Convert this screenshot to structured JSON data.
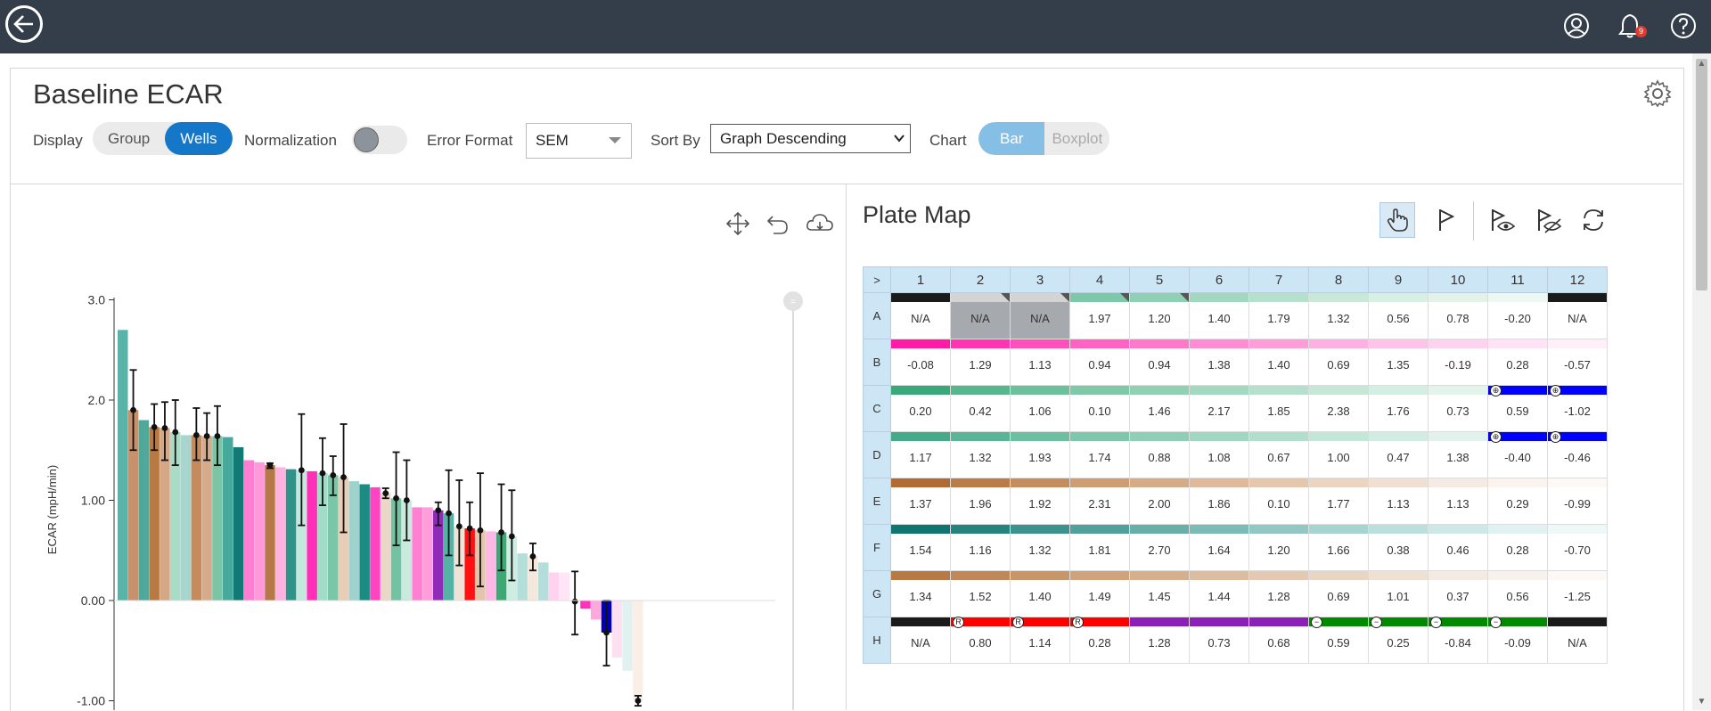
{
  "page": {
    "title": "Baseline ECAR",
    "notification_count": "9"
  },
  "toolbar": {
    "display_label": "Display",
    "display_options": [
      "Group",
      "Wells"
    ],
    "display_selected": "Wells",
    "normalization_label": "Normalization",
    "normalization_on": false,
    "error_format_label": "Error Format",
    "error_format_value": "SEM",
    "sort_by_label": "Sort By",
    "sort_by_value": "Graph Descending",
    "chart_label": "Chart",
    "chart_options": [
      "Bar",
      "Boxplot"
    ],
    "chart_selected": "Bar"
  },
  "icons": {
    "top": [
      "back-arrow-icon",
      "user-icon",
      "bell-icon",
      "help-icon"
    ],
    "panel": [
      "gear-icon"
    ],
    "chart_tools": [
      "pan-icon",
      "undo-icon",
      "cloud-download-icon"
    ],
    "plate_tools": [
      "hand-pointer-icon",
      "flag-icon",
      "flag-show-icon",
      "flag-hide-icon",
      "refresh-icon"
    ]
  },
  "chart_data": {
    "type": "bar",
    "ylabel": "ECAR (mpH/min)",
    "yticks": [
      "3.0",
      "2.0",
      "1.00",
      "0.00",
      "-1.00"
    ],
    "ylim": [
      -1.0,
      3.0
    ],
    "grid": false,
    "bars": [
      {
        "v": 2.7,
        "c": "#5ab3a8"
      },
      {
        "v": 1.9,
        "c": "#c7926b",
        "e": [
          1.5,
          2.3
        ]
      },
      {
        "v": 1.8,
        "c": "#4fa899"
      },
      {
        "v": 1.73,
        "c": "#b87a43",
        "e": [
          1.5,
          1.96
        ]
      },
      {
        "v": 1.72,
        "c": "#d4a886",
        "e": [
          1.4,
          1.98
        ]
      },
      {
        "v": 1.68,
        "c": "#a9dcc6",
        "e": [
          1.35,
          2.0
        ]
      },
      {
        "v": 1.65,
        "c": "#a8d5cf"
      },
      {
        "v": 1.65,
        "c": "#c58b5c",
        "e": [
          1.4,
          1.92
        ]
      },
      {
        "v": 1.64,
        "c": "#d6ab8c",
        "e": [
          1.4,
          1.87
        ]
      },
      {
        "v": 1.64,
        "c": "#7cc4a4",
        "e": [
          1.35,
          1.94
        ]
      },
      {
        "v": 1.63,
        "c": "#47a99b"
      },
      {
        "v": 1.53,
        "c": "#117a74"
      },
      {
        "v": 1.4,
        "c": "#ff7ed2"
      },
      {
        "v": 1.38,
        "c": "#ff9ad9"
      },
      {
        "v": 1.35,
        "c": "#b67847",
        "e": [
          1.32,
          1.37
        ]
      },
      {
        "v": 1.33,
        "c": "#ffb1e1"
      },
      {
        "v": 1.31,
        "c": "#2f938a"
      },
      {
        "v": 1.3,
        "c": "#c3e8dd",
        "e": [
          0.75,
          1.86
        ]
      },
      {
        "v": 1.29,
        "c": "#ff2fb8"
      },
      {
        "v": 1.27,
        "c": "#a3dbc9",
        "e": [
          0.95,
          1.62
        ]
      },
      {
        "v": 1.25,
        "c": "#79c6a8",
        "e": [
          1.05,
          1.44
        ]
      },
      {
        "v": 1.23,
        "c": "#e8cdb8",
        "e": [
          0.68,
          1.76
        ]
      },
      {
        "v": 1.19,
        "c": "#9fd2cd"
      },
      {
        "v": 1.16,
        "c": "#1c8b81"
      },
      {
        "v": 1.13,
        "c": "#ff44c1"
      },
      {
        "v": 1.07,
        "c": "#ead7c8",
        "e": [
          1.02,
          1.12
        ]
      },
      {
        "v": 1.02,
        "c": "#73c3a3",
        "e": [
          0.55,
          1.48
        ]
      },
      {
        "v": 1.0,
        "c": "#c9ebde",
        "e": [
          0.6,
          1.4
        ]
      },
      {
        "v": 0.93,
        "c": "#ff80d2"
      },
      {
        "v": 0.93,
        "c": "#ff9ddb"
      },
      {
        "v": 0.9,
        "c": "#8f2bb8",
        "e": [
          0.75,
          0.98
        ]
      },
      {
        "v": 0.87,
        "c": "#55b3a6",
        "e": [
          0.45,
          1.3
        ]
      },
      {
        "v": 0.74,
        "c": "#f0e2d6",
        "e": [
          0.35,
          1.2
        ]
      },
      {
        "v": 0.72,
        "c": "#ff1111",
        "e": [
          0.45,
          0.98
        ]
      },
      {
        "v": 0.7,
        "c": "#e3c5ac",
        "e": [
          0.14,
          1.27
        ]
      },
      {
        "v": 0.69,
        "c": "#ffb7e5"
      },
      {
        "v": 0.68,
        "c": "#3ca873",
        "e": [
          0.3,
          1.16
        ]
      },
      {
        "v": 0.64,
        "c": "#cfeee2",
        "e": [
          0.2,
          1.1
        ]
      },
      {
        "v": 0.47,
        "c": "#b3dfdb"
      },
      {
        "v": 0.44,
        "c": "#f4e7dc",
        "e": [
          0.3,
          0.57
        ]
      },
      {
        "v": 0.38,
        "c": "#b5dedb"
      },
      {
        "v": 0.28,
        "c": "#ffd2ef"
      },
      {
        "v": 0.28,
        "c": "#ffe5f5"
      },
      {
        "v": -0.01,
        "c": "#ffe5f5",
        "e": [
          -0.34,
          0.29
        ]
      },
      {
        "v": -0.08,
        "c": "#ff33bb"
      },
      {
        "v": -0.19,
        "c": "#ffa8de"
      },
      {
        "v": -0.32,
        "c": "#0000b8",
        "e": [
          -0.65,
          0.0
        ]
      },
      {
        "v": -0.57,
        "c": "#ffe0f3"
      },
      {
        "v": -0.7,
        "c": "#e0f1f0"
      },
      {
        "v": -1.0,
        "c": "#faefe6",
        "e": [
          -1.05,
          -0.95
        ]
      }
    ]
  },
  "plate_map": {
    "title": "Plate Map",
    "corner_label": ">",
    "columns": [
      "1",
      "2",
      "3",
      "4",
      "5",
      "6",
      "7",
      "8",
      "9",
      "10",
      "11",
      "12"
    ],
    "rows": [
      {
        "label": "A",
        "values": [
          "N/A",
          "N/A",
          "N/A",
          "1.97",
          "1.20",
          "1.40",
          "1.79",
          "1.32",
          "0.56",
          "0.78",
          "-0.20",
          "N/A"
        ]
      },
      {
        "label": "B",
        "values": [
          "-0.08",
          "1.29",
          "1.13",
          "0.94",
          "0.94",
          "1.38",
          "1.40",
          "0.69",
          "1.35",
          "-0.19",
          "0.28",
          "-0.57"
        ]
      },
      {
        "label": "C",
        "values": [
          "0.20",
          "0.42",
          "1.06",
          "0.10",
          "1.46",
          "2.17",
          "1.85",
          "2.38",
          "1.76",
          "0.73",
          "0.59",
          "-1.02"
        ]
      },
      {
        "label": "D",
        "values": [
          "1.17",
          "1.32",
          "1.93",
          "1.74",
          "0.88",
          "1.08",
          "0.67",
          "1.00",
          "0.47",
          "1.38",
          "-0.40",
          "-0.46"
        ]
      },
      {
        "label": "E",
        "values": [
          "1.37",
          "1.96",
          "1.92",
          "2.31",
          "2.00",
          "1.86",
          "0.10",
          "1.77",
          "1.13",
          "1.13",
          "0.29",
          "-0.99"
        ]
      },
      {
        "label": "F",
        "values": [
          "1.54",
          "1.16",
          "1.32",
          "1.81",
          "2.70",
          "1.64",
          "1.20",
          "1.66",
          "0.38",
          "0.46",
          "0.28",
          "-0.70"
        ]
      },
      {
        "label": "G",
        "values": [
          "1.34",
          "1.52",
          "1.40",
          "1.49",
          "1.45",
          "1.44",
          "1.28",
          "0.69",
          "1.01",
          "0.37",
          "0.56",
          "-1.25"
        ]
      },
      {
        "label": "H",
        "values": [
          "N/A",
          "0.80",
          "1.14",
          "0.28",
          "1.28",
          "0.73",
          "0.68",
          "0.59",
          "0.25",
          "-0.84",
          "-0.09",
          "N/A"
        ]
      }
    ],
    "row_colors": {
      "A": [
        "#1a1a1a",
        "#d4d4d4",
        "#d4d4d4",
        "#7dc8a8",
        "#8fd0b4",
        "#a2d8c0",
        "#b5e0cc",
        "#c8e8d8",
        "#d8efe3",
        "#e3f3ea",
        "#eef8f3",
        "#1a1a1a"
      ],
      "B": [
        "#ff1aa8",
        "#ff35b2",
        "#ff4fbb",
        "#ff62c3",
        "#ff78cb",
        "#ff8dd3",
        "#ff9ddb",
        "#ffb0e2",
        "#ffc2e9",
        "#ffd3ef",
        "#ffe2f5",
        "#ffeff9"
      ],
      "C": [
        "#3aa97a",
        "#58b68c",
        "#6cc09b",
        "#7fc9a8",
        "#90d1b4",
        "#a2d9c1",
        "#b4e0cd",
        "#c4e7d8",
        "#d3eee2",
        "#e2f4eb",
        "#0000ff",
        "#0000ff"
      ],
      "D": [
        "#44aa88",
        "#5ab496",
        "#6dbfa2",
        "#7ec7ad",
        "#8fcfb8",
        "#a0d7c3",
        "#b2dece",
        "#c2e6d8",
        "#d1ece2",
        "#e0f2eb",
        "#0000ff",
        "#0000ff"
      ],
      "E": [
        "#b06a32",
        "#bb7c48",
        "#c58d5e",
        "#ce9d74",
        "#d6ac88",
        "#deba9b",
        "#e5c7ae",
        "#ebd4c0",
        "#f1e0d2",
        "#f6ebe2",
        "#faf3ee",
        "#fdf9f6"
      ],
      "F": [
        "#0e7570",
        "#268480",
        "#3c928d",
        "#52a09b",
        "#68aea9",
        "#7dbbb7",
        "#92c8c4",
        "#a6d4d1",
        "#badfdd",
        "#cde9e7",
        "#dff2f1",
        "#eef8f8"
      ],
      "G": [
        "#b87a45",
        "#c08857",
        "#c89669",
        "#cfa37b",
        "#d6b08d",
        "#dcbd9f",
        "#e3c9b1",
        "#e9d5c3",
        "#eee0d3",
        "#f3eae1",
        "#f7f2ec",
        "#fbf8f5"
      ],
      "H": [
        "#1a1a1a",
        "#ff0000",
        "#ff0000",
        "#ff0000",
        "#8b1fb8",
        "#8b1fb8",
        "#8b1fb8",
        "#008a00",
        "#008a00",
        "#008a00",
        "#008a00",
        "#1a1a1a"
      ]
    },
    "markers": {
      "C": [
        "",
        "",
        "",
        "",
        "",
        "",
        "",
        "",
        "",
        "",
        "⊕",
        "⊕"
      ],
      "D": [
        "",
        "",
        "",
        "",
        "",
        "",
        "",
        "",
        "",
        "",
        "⊕",
        "⊕"
      ],
      "H": [
        "",
        "R",
        "R",
        "R",
        "",
        "",
        "",
        "−",
        "−",
        "−",
        "−",
        ""
      ]
    }
  }
}
